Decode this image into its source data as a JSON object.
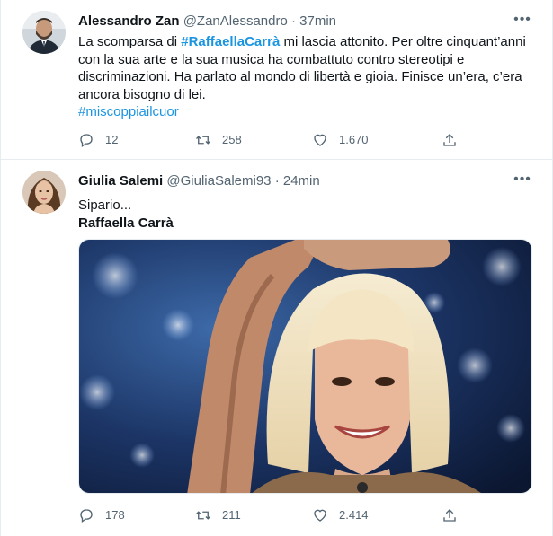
{
  "tweets": [
    {
      "author_name": "Alessandro Zan",
      "handle": "@ZanAlessandro",
      "separator": "·",
      "time": "37min",
      "text_before": "La scomparsa di ",
      "mention": "#RaffaellaCarrà",
      "text_after": " mi lascia attonito. Per oltre cinquant’anni con la sua arte e la sua musica ha combattuto contro stereotipi e discriminazioni. Ha parlato al mondo di libertà e gioia. Finisce un’era, c’era ancora bisogno di lei.",
      "hashtag": "#miscoppiailcuor",
      "replies": "12",
      "retweets": "258",
      "likes": "1.670"
    },
    {
      "author_name": "Giulia Salemi",
      "handle": "@GiuliaSalemi93",
      "separator": "·",
      "time": "24min",
      "line1": "Sipario...",
      "line2": "Raffaella Carrà",
      "replies": "178",
      "retweets": "211",
      "likes": "2.414"
    }
  ],
  "icons": {
    "more": "more-horizontal-icon",
    "reply": "reply-icon",
    "retweet": "retweet-icon",
    "like": "heart-icon",
    "share": "share-icon"
  },
  "colors": {
    "link": "#1b95e0",
    "secondary_text": "#536471",
    "divider": "#e6ecf0"
  }
}
